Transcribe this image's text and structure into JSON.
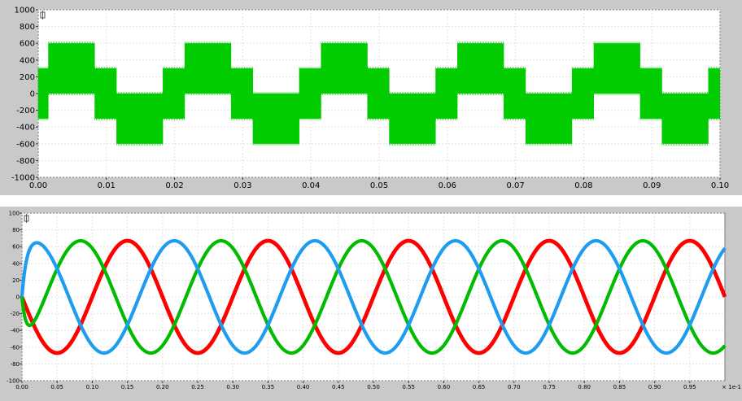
{
  "chart_data": [
    {
      "type": "line",
      "title": "",
      "xlabel": "",
      "ylabel": "",
      "xlim": [
        0,
        0.1
      ],
      "ylim": [
        -1000,
        1000
      ],
      "x_ticks": [
        "0.00",
        "0.01",
        "0.02",
        "0.03",
        "0.04",
        "0.05",
        "0.06",
        "0.07",
        "0.08",
        "0.09",
        "0.10"
      ],
      "y_ticks": [
        "1000",
        "800",
        "600",
        "400",
        "200",
        "0",
        "-200",
        "-400",
        "-600",
        "-800",
        "-1000"
      ],
      "grid": true,
      "legend": "none",
      "series": [
        {
          "color": "#00cc00",
          "style": "pwm-stepped",
          "period": 0.02,
          "steps": [
            {
              "x_start": 0.0,
              "x_end": 0.0015,
              "low": -300,
              "high": 300
            },
            {
              "x_start": 0.0015,
              "x_end": 0.0083,
              "low": 0,
              "high": 600
            },
            {
              "x_start": 0.0083,
              "x_end": 0.0115,
              "low": -300,
              "high": 300
            },
            {
              "x_start": 0.0115,
              "x_end": 0.0183,
              "low": -600,
              "high": 0
            },
            {
              "x_start": 0.0183,
              "x_end": 0.0215,
              "low": -300,
              "high": 300
            }
          ]
        }
      ]
    },
    {
      "type": "line",
      "title": "",
      "xlabel": "",
      "ylabel": "",
      "xlim": [
        0,
        1.0
      ],
      "ylim": [
        -100,
        100
      ],
      "x_ticks": [
        "0.00",
        "0.05",
        "0.10",
        "0.15",
        "0.20",
        "0.25",
        "0.30",
        "0.35",
        "0.40",
        "0.45",
        "0.50",
        "0.55",
        "0.60",
        "0.65",
        "0.70",
        "0.75",
        "0.80",
        "0.85",
        "0.90",
        "0.95"
      ],
      "x_multiplier": "× 1e-1",
      "y_ticks": [
        "100",
        "80",
        "60",
        "40",
        "20",
        "0",
        "-20",
        "-40",
        "-60",
        "-80",
        "-100"
      ],
      "grid": true,
      "legend": "none",
      "series": [
        {
          "color": "#ff0000",
          "amplitude": 67,
          "period": 0.2,
          "phase_deg": 0,
          "ripple": 3
        },
        {
          "color": "#00bb00",
          "amplitude": 67,
          "period": 0.2,
          "phase_deg": 120,
          "ripple": 2
        },
        {
          "color": "#1e9cf0",
          "amplitude": 67,
          "period": 0.2,
          "phase_deg": -120,
          "ripple": 2
        }
      ]
    }
  ],
  "icons": {
    "panel_top_icon": "cursor-icon",
    "panel_bottom_icon": "cursor-icon"
  }
}
